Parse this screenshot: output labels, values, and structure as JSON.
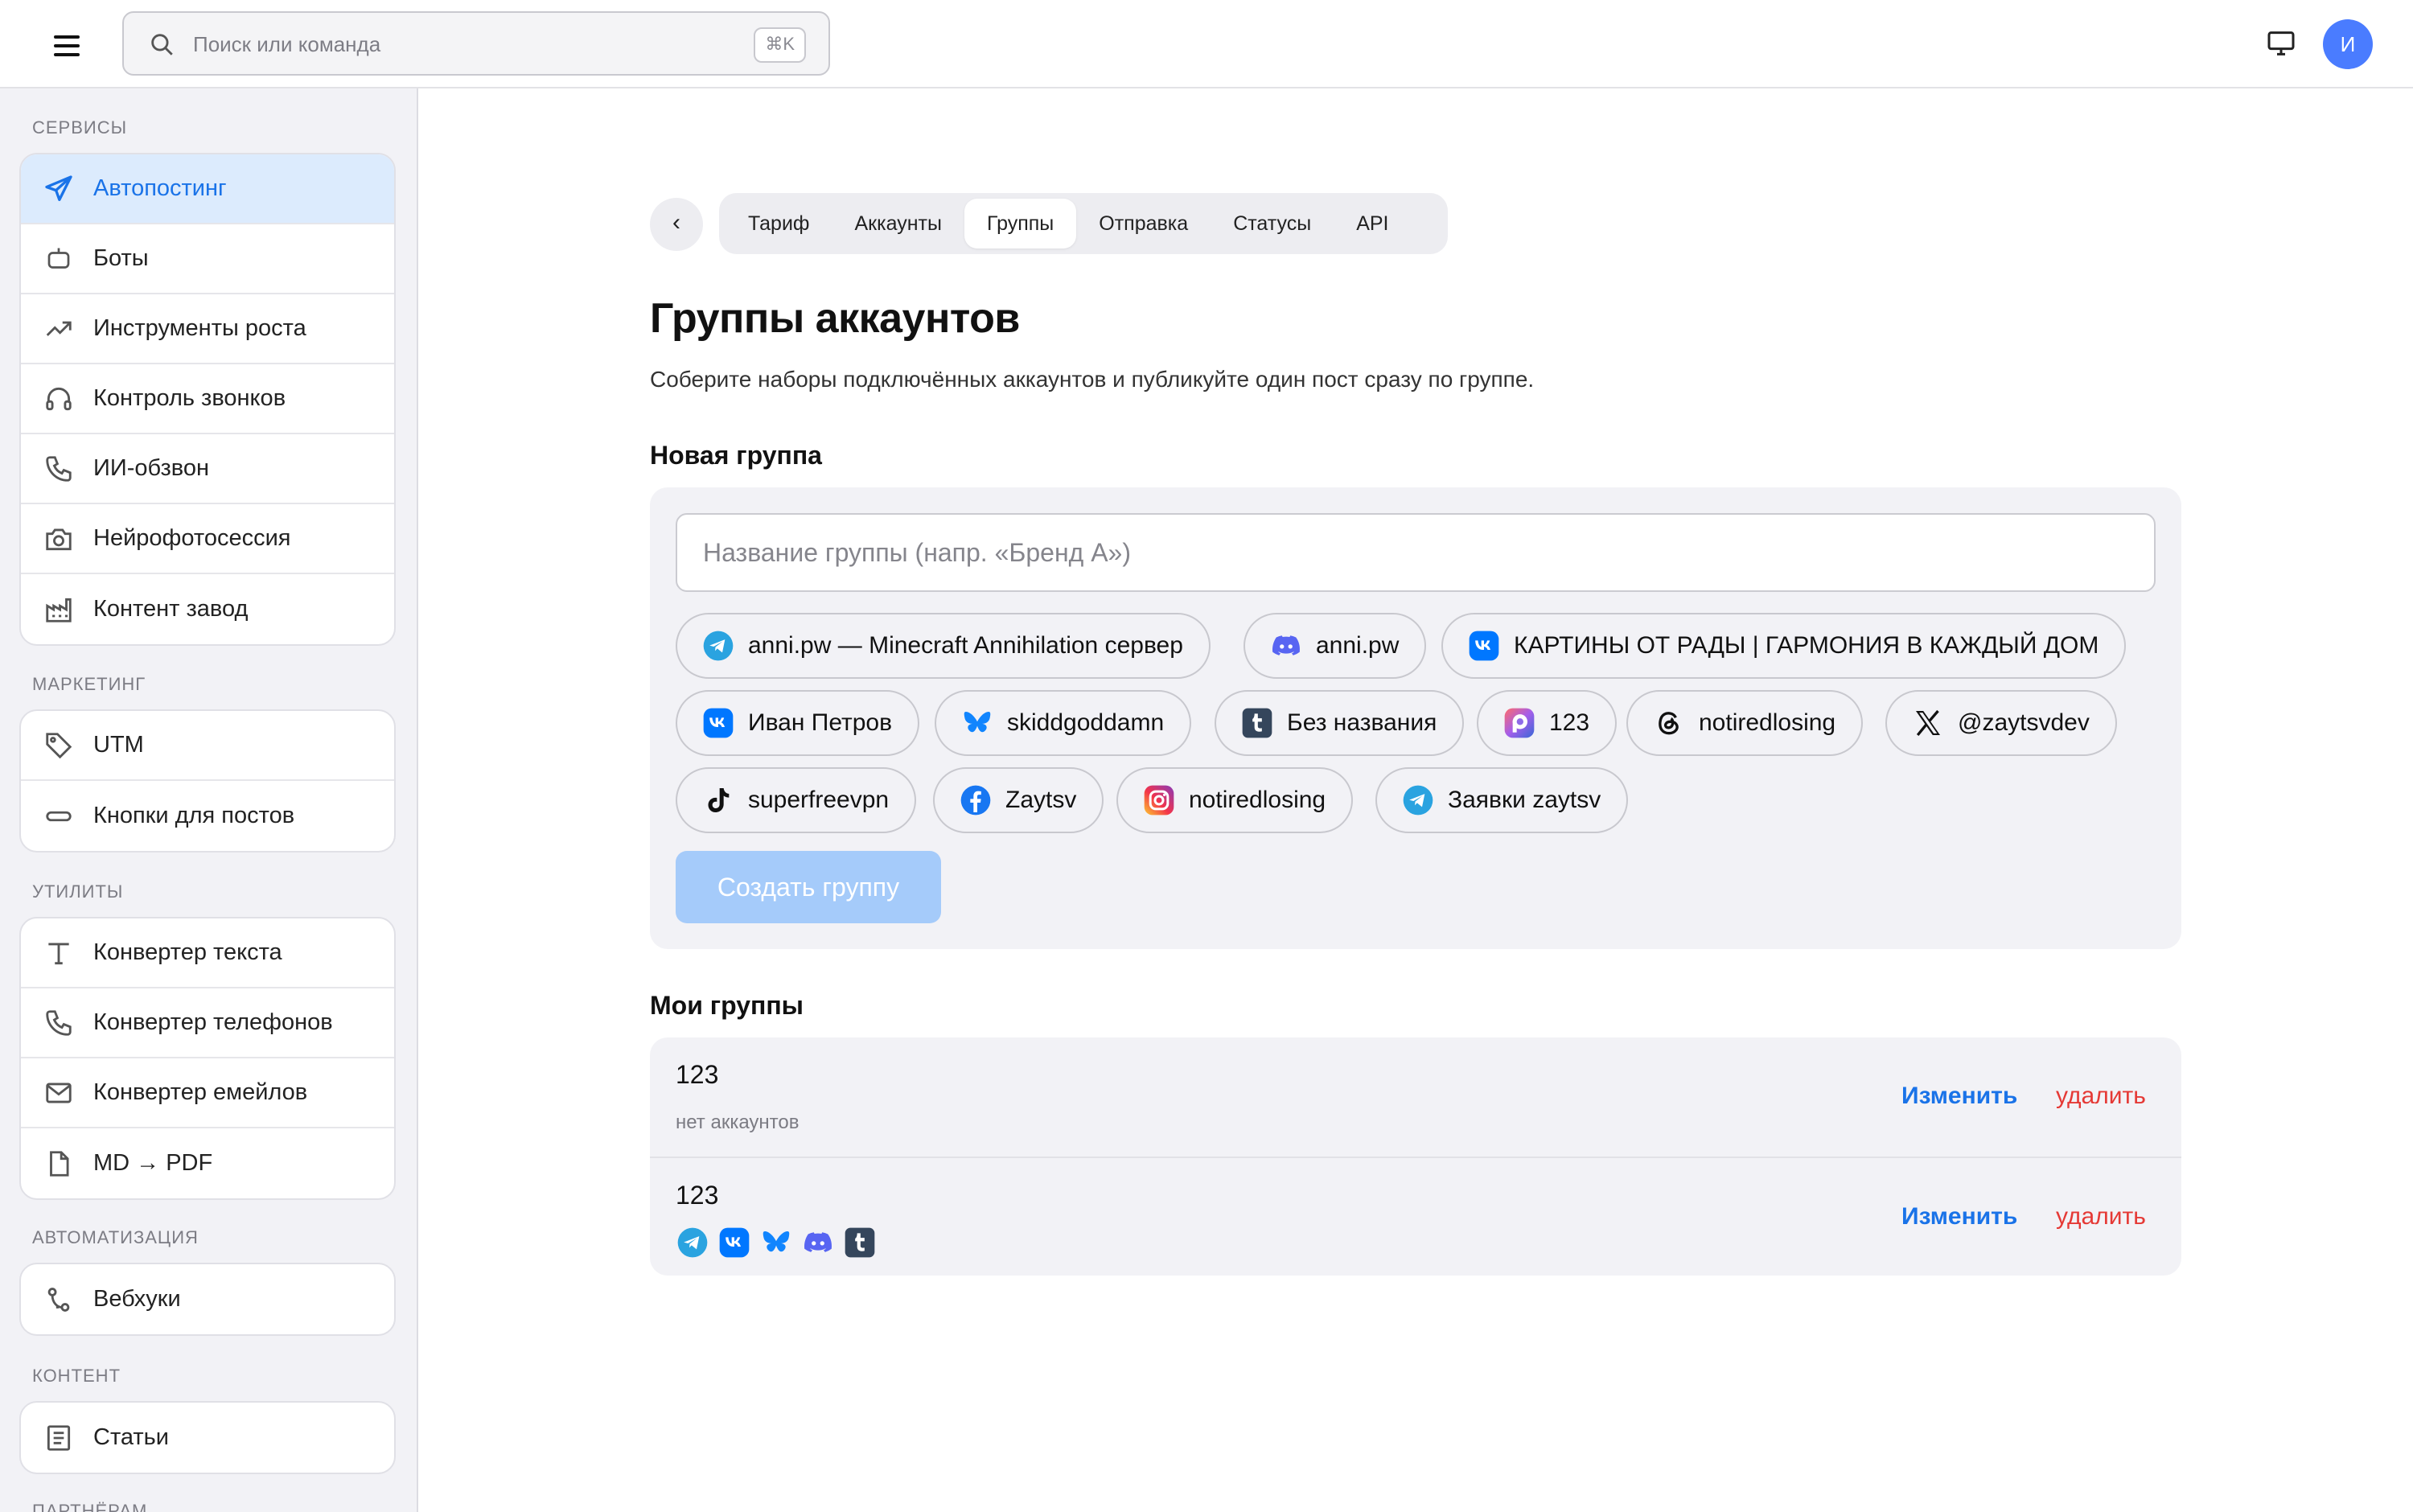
{
  "topbar": {
    "search_placeholder": "Поиск или команда",
    "search_shortcut": "⌘K",
    "avatar_initial": "И"
  },
  "sidebar": {
    "sections": [
      {
        "title": "СЕРВИСЫ",
        "items": [
          {
            "label": "Автопостинг",
            "icon": "send-icon",
            "active": true
          },
          {
            "label": "Боты",
            "icon": "bot-icon"
          },
          {
            "label": "Инструменты роста",
            "icon": "trending-up-icon"
          },
          {
            "label": "Контроль звонков",
            "icon": "headphones-icon"
          },
          {
            "label": "ИИ-обзвон",
            "icon": "phone-icon"
          },
          {
            "label": "Нейрофотосессия",
            "icon": "camera-icon"
          },
          {
            "label": "Контент завод",
            "icon": "factory-icon"
          }
        ]
      },
      {
        "title": "МАРКЕТИНГ",
        "items": [
          {
            "label": "UTM",
            "icon": "tag-icon"
          },
          {
            "label": "Кнопки для постов",
            "icon": "button-icon"
          }
        ]
      },
      {
        "title": "УТИЛИТЫ",
        "items": [
          {
            "label": "Конвертер текста",
            "icon": "text-icon"
          },
          {
            "label": "Конвертер телефонов",
            "icon": "phone-icon"
          },
          {
            "label": "Конвертер емейлов",
            "icon": "mail-icon"
          },
          {
            "label": "MD → PDF",
            "icon": "file-icon"
          }
        ]
      },
      {
        "title": "АВТОМАТИЗАЦИЯ",
        "items": [
          {
            "label": "Вебхуки",
            "icon": "webhook-icon"
          }
        ]
      },
      {
        "title": "КОНТЕНТ",
        "items": [
          {
            "label": "Статьи",
            "icon": "article-icon"
          }
        ]
      },
      {
        "title": "ПАРТНЁРАМ",
        "items": []
      }
    ]
  },
  "tabs": {
    "back_label": "‹",
    "items": [
      "Тариф",
      "Аккаунты",
      "Группы",
      "Отправка",
      "Статусы",
      "API"
    ],
    "active": "Группы"
  },
  "page": {
    "title": "Группы аккаунтов",
    "subtitle": "Соберите наборы подключённых аккаунтов и публикуйте один пост сразу по группе."
  },
  "new_group": {
    "heading": "Новая группа",
    "name_placeholder": "Название группы (напр. «Бренд А»)",
    "accounts": [
      {
        "label": "anni.pw — Minecraft Annihilation сервер",
        "platform": "telegram-icon"
      },
      {
        "label": "anni.pw",
        "platform": "discord-icon"
      },
      {
        "label": "КАРТИНЫ ОТ РАДЫ | ГАРМОНИЯ В КАЖДЫЙ ДОМ",
        "platform": "vk-icon"
      },
      {
        "label": "Иван Петров",
        "platform": "vk-icon"
      },
      {
        "label": "skiddgoddamn",
        "platform": "bluesky-icon"
      },
      {
        "label": "Без названия",
        "platform": "tumblr-icon"
      },
      {
        "label": "123",
        "platform": "pixelfed-icon"
      },
      {
        "label": "notiredlosing",
        "platform": "threads-icon"
      },
      {
        "label": "@zaytsvdev",
        "platform": "x-icon"
      },
      {
        "label": "superfreevpn",
        "platform": "tiktok-icon"
      },
      {
        "label": "Zaytsv",
        "platform": "facebook-icon"
      },
      {
        "label": "notiredlosing",
        "platform": "instagram-icon"
      },
      {
        "label": "Заявки zaytsv",
        "platform": "telegram-icon"
      }
    ],
    "create_label": "Создать группу"
  },
  "my_groups": {
    "heading": "Мои группы",
    "edit_label": "Изменить",
    "delete_label": "удалить",
    "rows": [
      {
        "name": "123",
        "subtitle": "нет аккаунтов",
        "icons": []
      },
      {
        "name": "123",
        "subtitle": "",
        "icons": [
          "telegram-icon",
          "vk-icon",
          "bluesky-icon",
          "discord-icon",
          "tumblr-icon"
        ]
      }
    ]
  },
  "colors": {
    "accent": "#1a73e8",
    "active_bg": "#dcebfd",
    "danger": "#e53935",
    "create_disabled": "#a5cbfa",
    "avatar": "#4a7cff"
  }
}
